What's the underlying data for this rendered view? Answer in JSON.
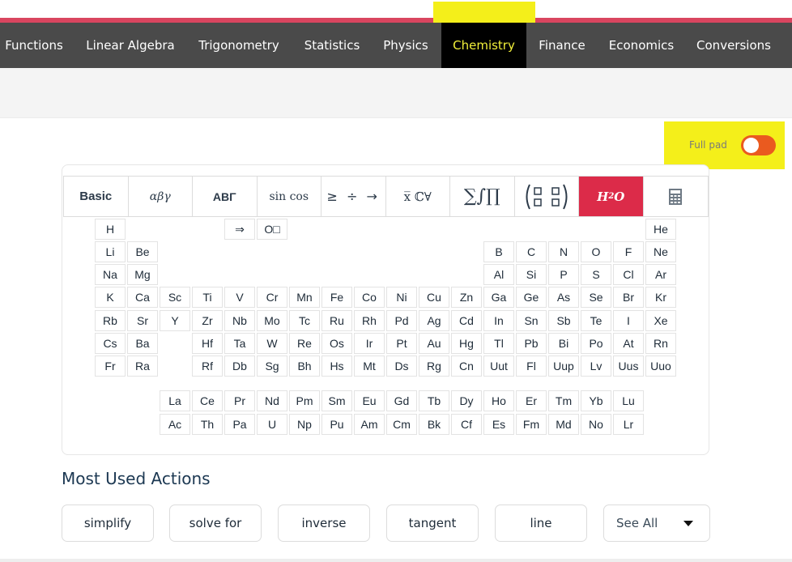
{
  "nav": {
    "items": [
      "Functions",
      "Linear Algebra",
      "Trigonometry",
      "Statistics",
      "Physics",
      "Chemistry",
      "Finance",
      "Economics",
      "Conversions"
    ],
    "active": "Chemistry"
  },
  "toggle": {
    "label": "Full pad",
    "on": true
  },
  "keypad": {
    "tabs": [
      {
        "id": "basic",
        "label": "Basic"
      },
      {
        "id": "greek-lower",
        "label": "αβγ"
      },
      {
        "id": "greek-upper",
        "label": "ΑΒΓ"
      },
      {
        "id": "trig",
        "label": "sin cos"
      },
      {
        "id": "operators",
        "label": "≥ ÷ →"
      },
      {
        "id": "sets",
        "label": "x̅ ℂ∀"
      },
      {
        "id": "sum-int",
        "label": "∑∫∏"
      },
      {
        "id": "matrix",
        "label": "matrix-icon"
      },
      {
        "id": "chemistry",
        "label": "H2O"
      },
      {
        "id": "calculator",
        "label": "calculator-icon"
      }
    ],
    "active_tab": "chemistry",
    "special_keys": [
      "⇒",
      "O□"
    ],
    "periodic_rows": [
      [
        "H",
        "He"
      ],
      [
        "Li",
        "Be",
        "B",
        "C",
        "N",
        "O",
        "F",
        "Ne"
      ],
      [
        "Na",
        "Mg",
        "Al",
        "Si",
        "P",
        "S",
        "Cl",
        "Ar"
      ],
      [
        "K",
        "Ca",
        "Sc",
        "Ti",
        "V",
        "Cr",
        "Mn",
        "Fe",
        "Co",
        "Ni",
        "Cu",
        "Zn",
        "Ga",
        "Ge",
        "As",
        "Se",
        "Br",
        "Kr"
      ],
      [
        "Rb",
        "Sr",
        "Y",
        "Zr",
        "Nb",
        "Mo",
        "Tc",
        "Ru",
        "Rh",
        "Pd",
        "Ag",
        "Cd",
        "In",
        "Sn",
        "Sb",
        "Te",
        "I",
        "Xe"
      ],
      [
        "Cs",
        "Ba",
        "Hf",
        "Ta",
        "W",
        "Re",
        "Os",
        "Ir",
        "Pt",
        "Au",
        "Hg",
        "Tl",
        "Pb",
        "Bi",
        "Po",
        "At",
        "Rn"
      ],
      [
        "Fr",
        "Ra",
        "Rf",
        "Db",
        "Sg",
        "Bh",
        "Hs",
        "Mt",
        "Ds",
        "Rg",
        "Cn",
        "Uut",
        "Fl",
        "Uup",
        "Lv",
        "Uus",
        "Uuo"
      ]
    ],
    "lanthanides": [
      "La",
      "Ce",
      "Pr",
      "Nd",
      "Pm",
      "Sm",
      "Eu",
      "Gd",
      "Tb",
      "Dy",
      "Ho",
      "Er",
      "Tm",
      "Yb",
      "Lu"
    ],
    "actinides": [
      "Ac",
      "Th",
      "Pa",
      "U",
      "Np",
      "Pu",
      "Am",
      "Cm",
      "Bk",
      "Cf",
      "Es",
      "Fm",
      "Md",
      "No",
      "Lr"
    ]
  },
  "most_used": {
    "title": "Most Used Actions",
    "actions": [
      "simplify",
      "solve for",
      "inverse",
      "tangent",
      "line"
    ],
    "see_all": "See All"
  },
  "colors": {
    "accent_red": "#dc2b49",
    "active_nav_text": "#f2f03a",
    "highlight": "#f4ef1a",
    "toggle_on": "#ea5a1f",
    "nav_bg": "#4a4a4a"
  }
}
